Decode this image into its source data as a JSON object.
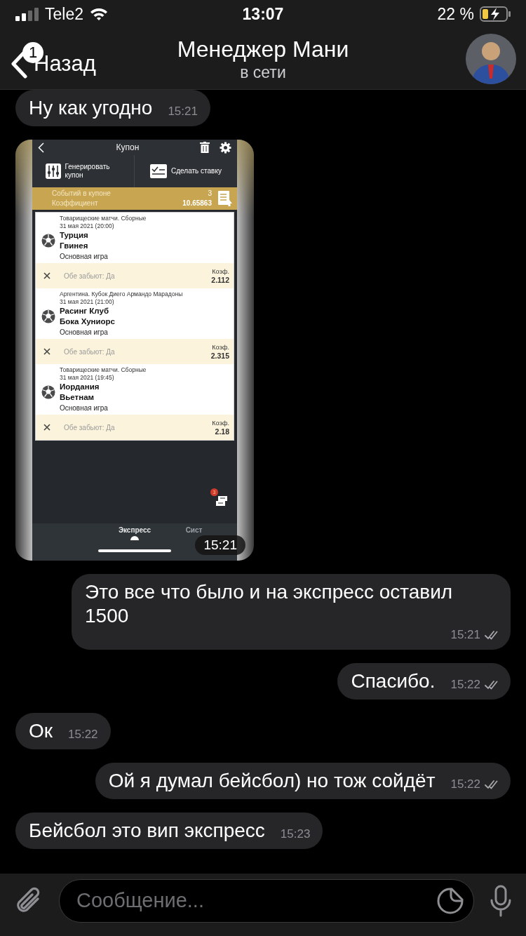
{
  "status_bar": {
    "carrier": "Tele2",
    "time": "13:07",
    "battery": "22 %"
  },
  "header": {
    "back_label": "Назад",
    "unread_badge": "1",
    "title": "Менеджер Мани",
    "subtitle": "в сети"
  },
  "messages": [
    {
      "kind": "text",
      "outgoing": false,
      "text": "Ну как угодно",
      "time": "15:21"
    },
    {
      "kind": "image",
      "outgoing": false,
      "time": "15:21",
      "screenshot": {
        "title": "Купон",
        "actions": [
          {
            "label": "Генерировать купон",
            "kind": "generate"
          },
          {
            "label": "Сделать ставку",
            "kind": "bet"
          }
        ],
        "summary": {
          "events_label": "Событий в купоне",
          "events_count": "3",
          "coef_label": "Коэффициент",
          "coef_value": "10.65863"
        },
        "bets": [
          {
            "league": "Товарищеские матчи. Сборные",
            "date": "31 мая 2021 (20:00)",
            "team_1": "Турция",
            "team_2": "Гвинея",
            "market": "Основная игра",
            "outcome": "Обе забьют: Да",
            "odds_label": "Коэф.",
            "odds": "2.112"
          },
          {
            "league": "Аргентина. Кубок Диего Армандо Марадоны",
            "date": "31 мая 2021 (21:00)",
            "team_1": "Расинг Клуб",
            "team_2": "Бока Хуниорс",
            "market": "Основная игра",
            "outcome": "Обе забьют: Да",
            "odds_label": "Коэф.",
            "odds": "2.315"
          },
          {
            "league": "Товарищеские матчи. Сборные",
            "date": "31 мая 2021 (19:45)",
            "team_1": "Иордания",
            "team_2": "Вьетнам",
            "market": "Основная игра",
            "outcome": "Обе забьют: Да",
            "odds_label": "Коэф.",
            "odds": "2.18"
          }
        ],
        "fab_badge": "3",
        "tabs": [
          {
            "label": "Экспресс",
            "selected": true
          },
          {
            "label": "Сист",
            "selected": false
          }
        ]
      }
    },
    {
      "kind": "text",
      "outgoing": true,
      "text": "Это все что было и на экспресс оставил 1500",
      "time": "15:21",
      "read": true
    },
    {
      "kind": "text",
      "outgoing": true,
      "text": "Спасибо.",
      "time": "15:22",
      "read": true
    },
    {
      "kind": "text",
      "outgoing": false,
      "text": "Ок",
      "time": "15:22"
    },
    {
      "kind": "text",
      "outgoing": true,
      "text": "Ой я думал бейсбол) но тож сойдёт",
      "time": "15:22",
      "read": true
    },
    {
      "kind": "text",
      "outgoing": false,
      "text": "Бейсбол это вип экспресс",
      "time": "15:23"
    }
  ],
  "composer": {
    "placeholder": "Сообщение..."
  }
}
